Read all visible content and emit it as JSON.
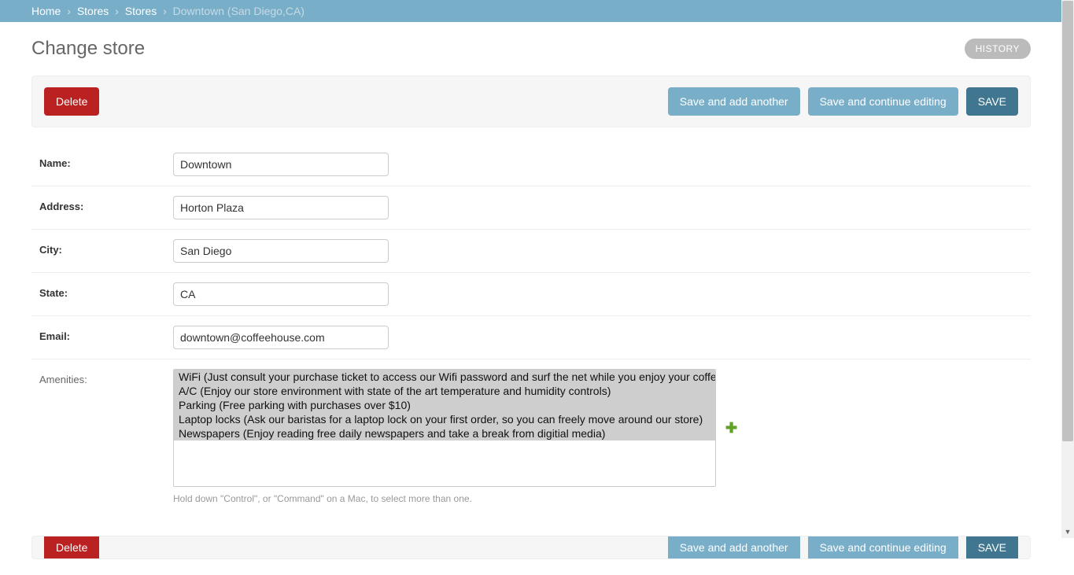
{
  "breadcrumb": {
    "home": "Home",
    "level1": "Stores",
    "level2": "Stores",
    "current": "Downtown (San Diego,CA)",
    "sep": "›"
  },
  "pageTitle": "Change store",
  "buttons": {
    "history": "HISTORY",
    "delete": "Delete",
    "saveAddAnother": "Save and add another",
    "saveContinue": "Save and continue editing",
    "save": "SAVE"
  },
  "labels": {
    "name": "Name:",
    "address": "Address:",
    "city": "City:",
    "state": "State:",
    "email": "Email:",
    "amenities": "Amenities:"
  },
  "values": {
    "name": "Downtown",
    "address": "Horton Plaza",
    "city": "San Diego",
    "state": "CA",
    "email": "downtown@coffeehouse.com"
  },
  "amenities": {
    "options": [
      "WiFi (Just consult your purchase ticket to access our Wifi password and surf the net while you enjoy your coffee)",
      "A/C (Enjoy our store environment with state of the art temperature and humidity controls)",
      "Parking (Free parking with purchases over $10)",
      "Laptop locks (Ask our baristas for a laptop lock on your first order, so you can freely move around our store)",
      "Newspapers (Enjoy reading free daily newspapers and take a break from digitial media)"
    ],
    "help": "Hold down \"Control\", or \"Command\" on a Mac, to select more than one."
  }
}
